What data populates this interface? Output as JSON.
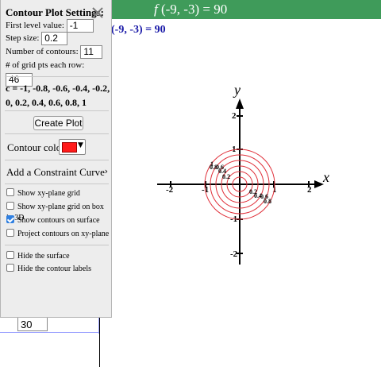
{
  "header": {
    "fn_label": "f",
    "fn_args": "(-9, -3) = 90"
  },
  "subtitle": "(-9, -3) = 90",
  "panel": {
    "title": "Contour Plot Settings:",
    "fields": {
      "first_level_label": "First level value:",
      "first_level_value": "-1",
      "step_label": "Step size:",
      "step_value": "0.2",
      "num_contours_label": "Number of contours:",
      "num_contours_value": "11",
      "grid_pts_label": "# of grid pts each row:",
      "grid_pts_value": "46"
    },
    "levels_text": "c = -1, -0.8, -0.6, -0.4, -0.2, 0, 0.2, 0.4, 0.6, 0.8, 1",
    "create_button": "Create Plot",
    "contour_color_label": "Contour color:",
    "contour_color": "#ff1a1a",
    "constraint_label": "Add a Constraint Curve",
    "checkboxes": [
      {
        "label": "Show xy-plane grid",
        "checked": false
      },
      {
        "label": "Show xy-plane grid on box in 3D",
        "checked": false
      },
      {
        "label": "Show contours on surface",
        "checked": true
      },
      {
        "label": "Project contours on xy-plane",
        "checked": false
      },
      {
        "label": "Hide the surface",
        "checked": false
      },
      {
        "label": "Hide the contour labels",
        "checked": false
      }
    ]
  },
  "bottom_input_value": "30",
  "plot": {
    "x_axis_label": "x",
    "y_axis_label": "y",
    "x_ticks": [
      "-2",
      "-1",
      "1",
      "2"
    ],
    "y_ticks": [
      "2",
      "1",
      "-1",
      "-2"
    ],
    "contour_color": "#e0303a",
    "contour_labels_left": [
      "1",
      "0.8",
      "0.6",
      "0.4",
      "0.2"
    ],
    "contour_labels_right": [
      "0.2",
      "0.4",
      "0.6",
      "0.8"
    ]
  }
}
